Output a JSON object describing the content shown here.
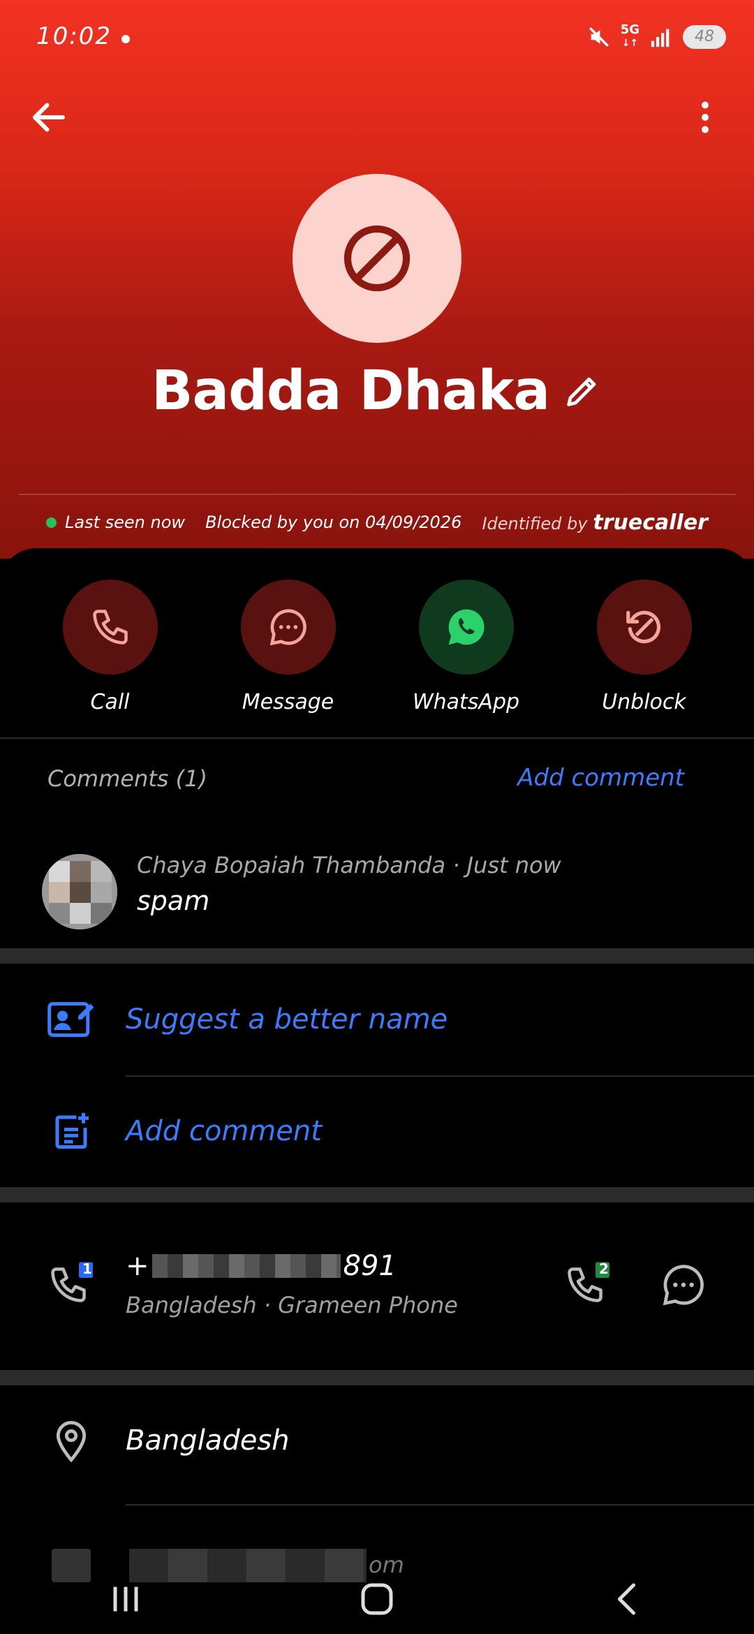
{
  "status_bar": {
    "time": "10:02",
    "battery": "48",
    "network": "5G"
  },
  "header": {
    "contact_name": "Badda Dhaka",
    "last_seen": "Last seen now",
    "blocked_info": "Blocked by you on 04/09/2026",
    "identified_by": "Identified by",
    "brand": "truecaller"
  },
  "actions": [
    {
      "label": "Call",
      "icon": "phone-icon",
      "color": "#5a1210"
    },
    {
      "label": "Message",
      "icon": "chat-bubble-icon",
      "color": "#5a1210"
    },
    {
      "label": "WhatsApp",
      "icon": "whatsapp-icon",
      "color": "#0f3a1e"
    },
    {
      "label": "Unblock",
      "icon": "unblock-icon",
      "color": "#5a1210"
    }
  ],
  "comments": {
    "heading": "Comments (1)",
    "add_link": "Add comment",
    "items": [
      {
        "author": "Chaya Bopaiah Thambanda",
        "time": "Just now",
        "separator": " · ",
        "text": "spam"
      }
    ]
  },
  "options": {
    "suggest_name": "Suggest a better name",
    "add_comment": "Add comment"
  },
  "phone": {
    "prefix": "+",
    "suffix": "891",
    "details": "Bangladesh · Grameen Phone",
    "sim1_badge": "1",
    "sim2_badge": "2"
  },
  "location": {
    "country": "Bangladesh"
  },
  "email": {
    "tail": "om"
  },
  "colors": {
    "accent_blue": "#3b7bff",
    "header_red": "#e22b1d",
    "whatsapp_green": "#2bd16a"
  }
}
